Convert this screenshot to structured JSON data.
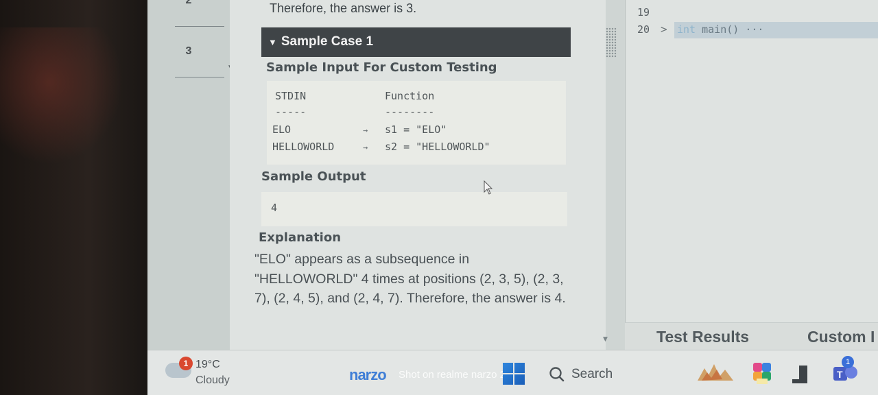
{
  "rail": {
    "numbers": [
      "2",
      "3"
    ]
  },
  "problem": {
    "intro_tail": "Therefore, the answer is 3.",
    "sample_case_title": "Sample Case 1",
    "sample_input_heading": "Sample Input For Custom Testing",
    "sample_input": {
      "col_headers": [
        "STDIN",
        "Function"
      ],
      "col_underlines": [
        "-----",
        "--------"
      ],
      "rows": [
        {
          "stdin": "ELO",
          "function": "s1 = \"ELO\""
        },
        {
          "stdin": "HELLOWORLD",
          "function": "s2 = \"HELLOWORLD\""
        }
      ]
    },
    "sample_output_heading": "Sample Output",
    "sample_output": "4",
    "explanation_heading": "Explanation",
    "explanation_text": "\"ELO\" appears as a subsequence in \"HELLOWORLD\" 4 times at positions (2, 3, 5), (2, 3, 7), (2, 4, 5), and (2, 4, 7). Therefore, the answer is 4."
  },
  "editor": {
    "line_numbers": [
      "19",
      "20"
    ],
    "fold_marker": ">",
    "code_keyword": "int",
    "code_rest": " main() ···"
  },
  "results": {
    "tab_test_results": "Test Results",
    "tab_custom": "Custom I"
  },
  "taskbar": {
    "weather_badge": "1",
    "temperature": "19°C",
    "condition": "Cloudy",
    "watermark_brand": "narzo",
    "watermark_text": "Shot on realme narzo 20",
    "search_label": "Search",
    "teams_badge": "1",
    "icons": [
      "weather-cloud-icon",
      "windows-start-icon",
      "search-icon",
      "photos-icon",
      "copilot-icon",
      "file-icon",
      "teams-icon"
    ]
  },
  "colors": {
    "case_header_bg": "#3f4447",
    "scrollbar_thumb": "#9aa8b2",
    "code_highlight": "#c2cfd6",
    "badge_red": "#d94830",
    "brand_blue": "#3f7ed6"
  }
}
